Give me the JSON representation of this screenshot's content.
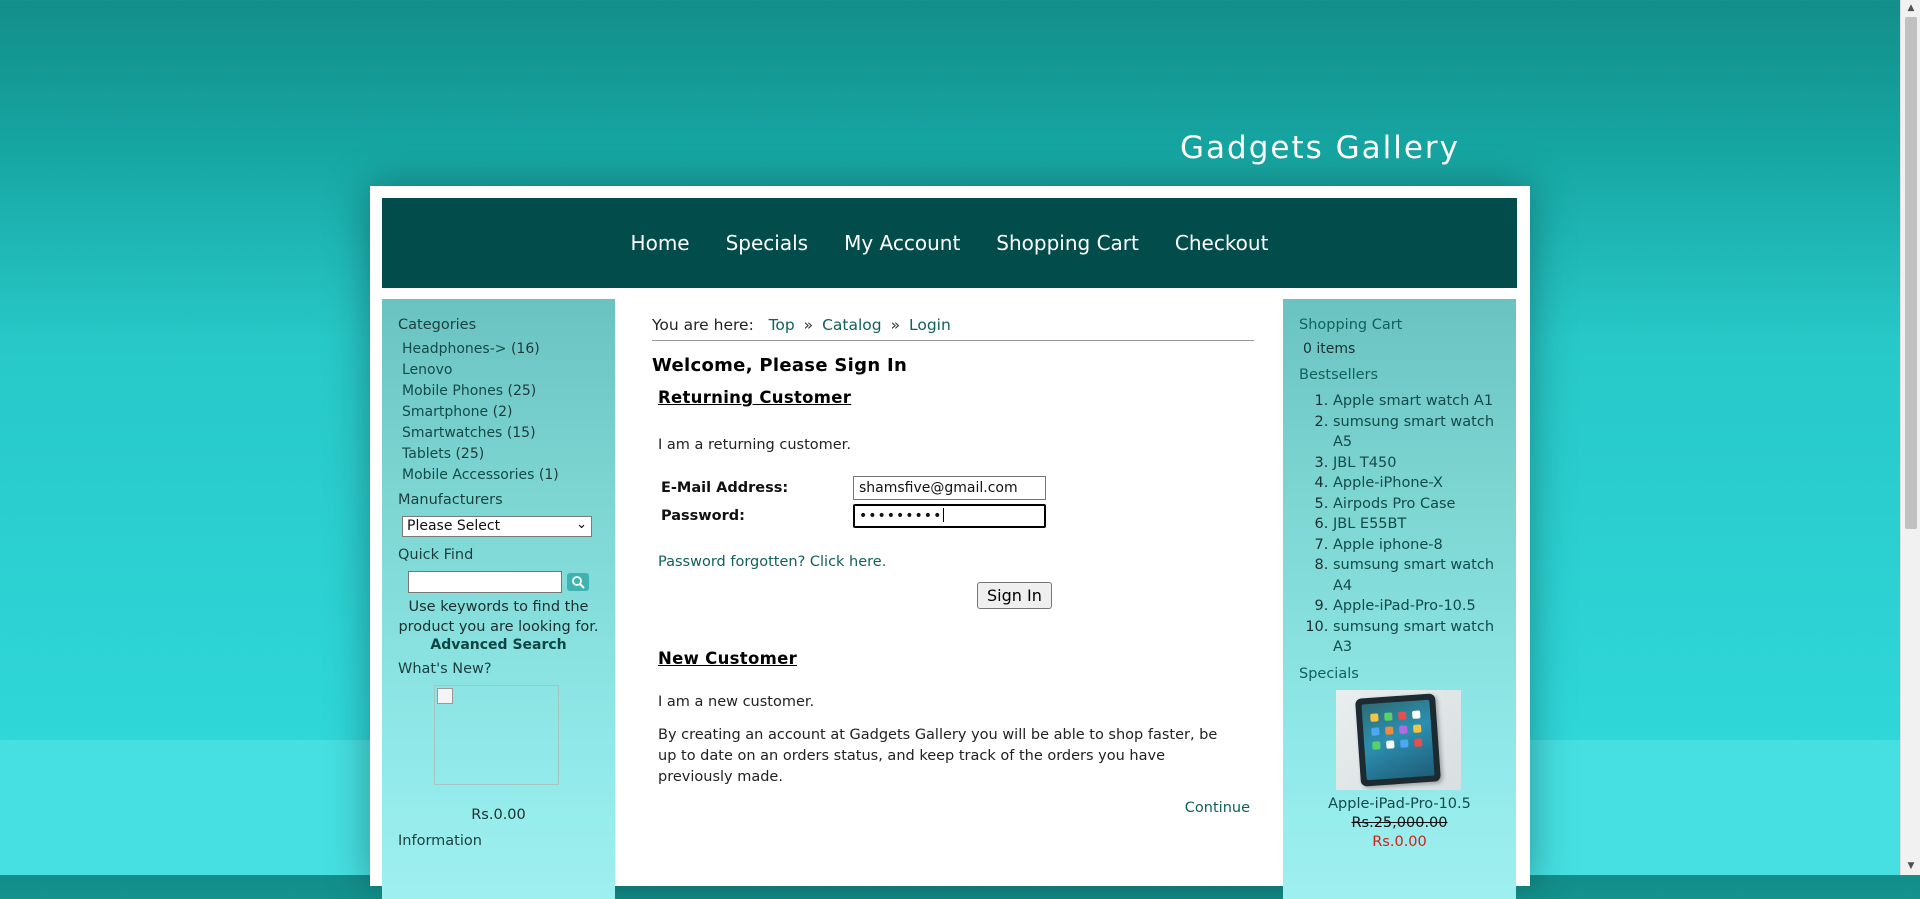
{
  "site": {
    "title": "Gadgets Gallery"
  },
  "nav": [
    {
      "label": "Home"
    },
    {
      "label": "Specials"
    },
    {
      "label": "My Account"
    },
    {
      "label": "Shopping Cart"
    },
    {
      "label": "Checkout"
    }
  ],
  "left_sidebar": {
    "categories_heading": "Categories",
    "categories": [
      {
        "name": "Headphones->",
        "count": "(16)"
      },
      {
        "name": "Lenovo",
        "count": ""
      },
      {
        "name": "Mobile Phones",
        "count": "(25)"
      },
      {
        "name": "Smartphone",
        "count": "(2)"
      },
      {
        "name": "Smartwatches",
        "count": "(15)"
      },
      {
        "name": "Tablets",
        "count": "(25)"
      },
      {
        "name": "Mobile Accessories",
        "count": "(1)"
      }
    ],
    "manufacturers_heading": "Manufacturers",
    "manufacturers_selected": "Please Select",
    "quick_find_heading": "Quick Find",
    "quick_find_value": "",
    "quick_find_help": "Use keywords to find the product you are looking for.",
    "advanced_search": "Advanced Search",
    "whats_new_heading": "What's New?",
    "whats_new_price": "Rs.0.00",
    "information_heading": "Information"
  },
  "main": {
    "breadcrumb_prefix": "You are here:",
    "breadcrumb": [
      "Top",
      "Catalog",
      "Login"
    ],
    "breadcrumb_sep": "»",
    "page_title": "Welcome, Please Sign In",
    "returning": {
      "title": "Returning Customer",
      "intro": "I am a returning customer.",
      "email_label": "E-Mail Address:",
      "email_value": "shamsfive@gmail.com",
      "password_label": "Password:",
      "password_value": "•••••••••",
      "forgot_link": "Password forgotten? Click here.",
      "sign_in_button": "Sign In"
    },
    "new_customer": {
      "title": "New Customer",
      "intro": "I am a new customer.",
      "description": "By creating an account at Gadgets Gallery you will be able to shop faster, be up to date on an orders status, and keep track of the orders you have previously made.",
      "continue_link": "Continue"
    }
  },
  "right_sidebar": {
    "cart_heading": "Shopping Cart",
    "cart_items": "0 items",
    "bestsellers_heading": "Bestsellers",
    "bestsellers": [
      "Apple smart watch A1",
      "sumsung smart watch A5",
      "JBL T450",
      "Apple-iPhone-X",
      "Airpods Pro Case",
      "JBL E55BT",
      "Apple iphone-8",
      "sumsung smart watch A4",
      "Apple-iPad-Pro-10.5",
      "sumsung smart watch A3"
    ],
    "specials_heading": "Specials",
    "special_product": {
      "name": "Apple-iPad-Pro-10.5",
      "old_price": "Rs.25,000.00",
      "new_price": "Rs.0.00"
    }
  },
  "colors": {
    "nav_bg": "#024d4b",
    "link": "#11605d",
    "special_price": "#d31f17"
  }
}
